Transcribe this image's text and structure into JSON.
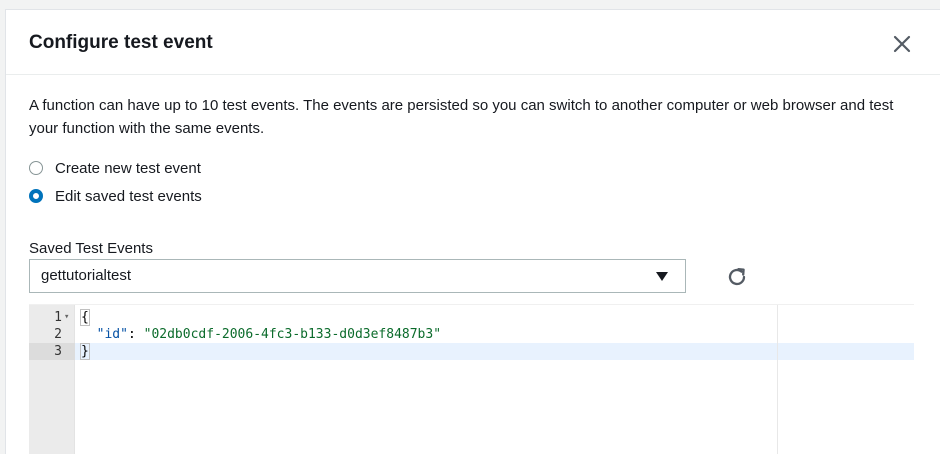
{
  "modal": {
    "title": "Configure test event",
    "close_icon": "close-icon",
    "description": "A function can have up to 10 test events. The events are persisted so you can switch to another computer or web browser and test your function with the same events."
  },
  "options": [
    {
      "label": "Create new test event",
      "checked": false
    },
    {
      "label": "Edit saved test events",
      "checked": true
    }
  ],
  "saved_events": {
    "label": "Saved Test Events",
    "selected": "gettutorialtest",
    "caret_icon": "caret-down-icon",
    "refresh_icon": "refresh-icon"
  },
  "editor": {
    "line_numbers": [
      "1",
      "2",
      "3"
    ],
    "fold_marker": "▾",
    "line1": "{",
    "line2_key": "\"id\"",
    "line2_colon": ": ",
    "line2_value": "\"02db0cdf-2006-4fc3-b133-d0d3ef8487b3\"",
    "line3": "}",
    "active_line": 3
  },
  "colors": {
    "accent": "#0073bb",
    "text": "#16191f",
    "string": "#0b6b2b",
    "key": "#0451a5"
  }
}
